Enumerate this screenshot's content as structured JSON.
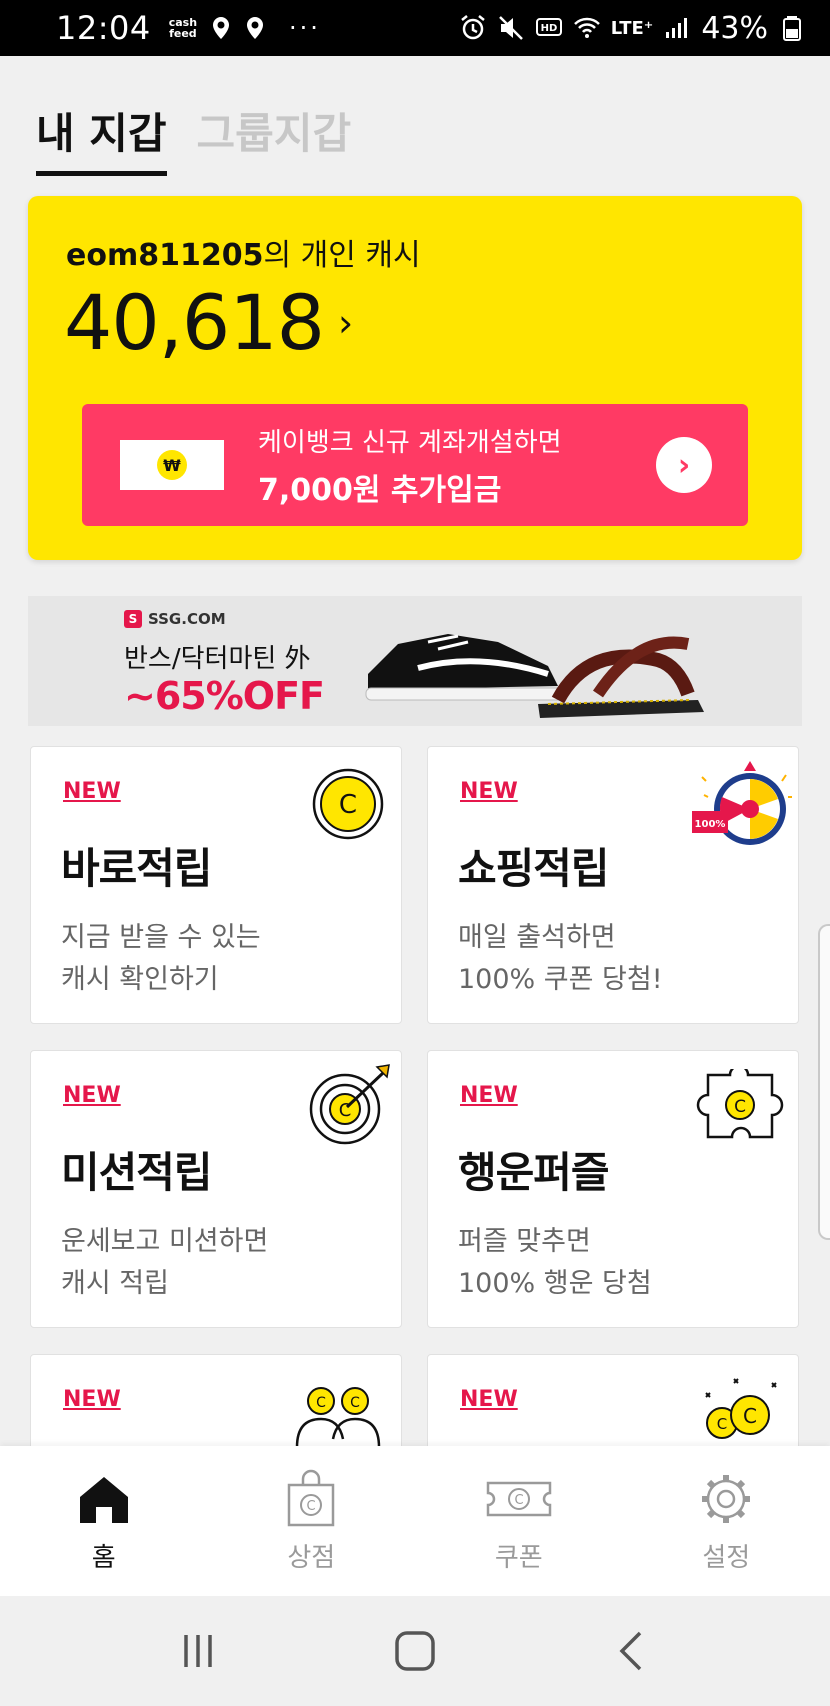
{
  "status_bar": {
    "time": "12:04",
    "cash_line1": "cash",
    "cash_line2": "feed",
    "more": "···",
    "lte": "LTE⁺",
    "battery": "43%"
  },
  "tabs": [
    {
      "label": "내 지갑",
      "active": true
    },
    {
      "label": "그룹지갑",
      "active": false
    }
  ],
  "wallet": {
    "user_id": "eom811205",
    "owner_suffix": "의 개인 캐시",
    "amount": "40,618",
    "chevron": "›",
    "kbank_line1": "케이뱅크 신규 계좌개설하면",
    "kbank_line2": "7,000원 추가입금",
    "kbank_logo_symbol": "₩",
    "kbank_go": "›"
  },
  "banner": {
    "brand": "SSG.COM",
    "brand_mark": "S",
    "headline": "반스/닥터마틴 外",
    "offer": "~65%OFF"
  },
  "cards": [
    {
      "badge": "NEW",
      "title": "바로적립",
      "desc_line1": "지금 받을 수 있는",
      "desc_line2": "캐시 확인하기",
      "icon": "coin-icon"
    },
    {
      "badge": "NEW",
      "title": "쇼핑적립",
      "desc_line1": "매일 출석하면",
      "desc_line2": "100% 쿠폰 당첨!",
      "icon": "roulette-icon",
      "icon_tag": "100%"
    },
    {
      "badge": "NEW",
      "title": "미션적립",
      "desc_line1": "운세보고 미션하면",
      "desc_line2": "캐시 적립",
      "icon": "target-icon"
    },
    {
      "badge": "NEW",
      "title": "행운퍼즐",
      "desc_line1": "퍼즐 맞추면",
      "desc_line2": "100% 행운 당첨",
      "icon": "puzzle-icon"
    },
    {
      "badge": "NEW",
      "icon": "friends-icon"
    },
    {
      "badge": "NEW",
      "icon": "balloon-coins-icon"
    }
  ],
  "bottom_nav": [
    {
      "label": "홈",
      "icon": "home-icon",
      "active": true
    },
    {
      "label": "상점",
      "icon": "shop-bag-icon",
      "active": false
    },
    {
      "label": "쿠폰",
      "icon": "coupon-icon",
      "active": false
    },
    {
      "label": "설정",
      "icon": "gear-icon",
      "active": false
    }
  ],
  "colors": {
    "wallet_bg": "#ffe600",
    "kbank_bg": "#ff3a64",
    "accent_red": "#e5174b",
    "tab_inactive": "#c7c7c7"
  }
}
